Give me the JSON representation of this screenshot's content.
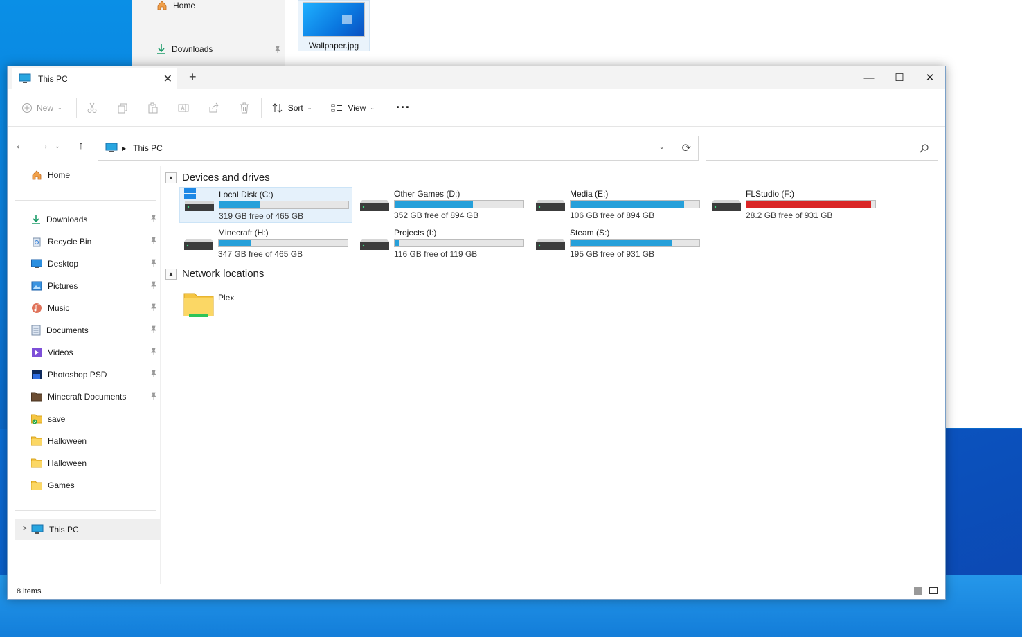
{
  "background_window": {
    "nav_home": "Home",
    "nav_downloads": "Downloads",
    "thumbnail_caption": "Wallpaper.jpg"
  },
  "window": {
    "tab_title": "This PC",
    "new_tab_glyph": "+",
    "close_glyph": "✕",
    "minimize_glyph": "—",
    "maximize_glyph": "☐"
  },
  "toolbar": {
    "new_label": "New",
    "sort_label": "Sort",
    "view_label": "View",
    "more_glyph": "···",
    "icons": [
      "plus-circle-icon",
      "cut-icon",
      "copy-icon",
      "paste-icon",
      "rename-icon",
      "share-icon",
      "delete-icon",
      "sort-icon",
      "view-icon",
      "more-icon"
    ]
  },
  "address": {
    "path": "This PC",
    "search_placeholder": ""
  },
  "sidebar": {
    "home": "Home",
    "items": [
      {
        "label": "Downloads",
        "icon": "download-icon",
        "pinned": true
      },
      {
        "label": "Recycle Bin",
        "icon": "recycle-bin-icon",
        "pinned": true
      },
      {
        "label": "Desktop",
        "icon": "desktop-icon",
        "pinned": true
      },
      {
        "label": "Pictures",
        "icon": "pictures-icon",
        "pinned": true
      },
      {
        "label": "Music",
        "icon": "music-icon",
        "pinned": true
      },
      {
        "label": "Documents",
        "icon": "documents-icon",
        "pinned": true
      },
      {
        "label": "Videos",
        "icon": "videos-icon",
        "pinned": true
      },
      {
        "label": "Photoshop PSD",
        "icon": "photoshop-icon",
        "pinned": true
      },
      {
        "label": "Minecraft Documents",
        "icon": "folder-dark-icon",
        "pinned": true
      },
      {
        "label": "save",
        "icon": "folder-check-icon",
        "pinned": false
      },
      {
        "label": "Halloween",
        "icon": "folder-icon",
        "pinned": false
      },
      {
        "label": "Halloween",
        "icon": "folder-icon",
        "pinned": false
      },
      {
        "label": "Games",
        "icon": "folder-icon",
        "pinned": false
      }
    ],
    "this_pc": "This PC"
  },
  "content": {
    "devices_header": "Devices and drives",
    "network_header": "Network locations",
    "drives": [
      {
        "name": "Local Disk (C:)",
        "free": "319 GB free of 465 GB",
        "used_fraction": 0.31,
        "color": "#26a0da",
        "system": true
      },
      {
        "name": "Other Games (D:)",
        "free": "352 GB free of 894 GB",
        "used_fraction": 0.61,
        "color": "#26a0da"
      },
      {
        "name": "Media (E:)",
        "free": "106 GB free of 894 GB",
        "used_fraction": 0.88,
        "color": "#26a0da"
      },
      {
        "name": "FLStudio (F:)",
        "free": "28.2 GB free of 931 GB",
        "used_fraction": 0.97,
        "color": "#da2626"
      },
      {
        "name": "Minecraft (H:)",
        "free": "347 GB free of 465 GB",
        "used_fraction": 0.25,
        "color": "#26a0da"
      },
      {
        "name": "Projects (I:)",
        "free": "116 GB free of 119 GB",
        "used_fraction": 0.03,
        "color": "#26a0da"
      },
      {
        "name": "Steam (S:)",
        "free": "195 GB free of 931 GB",
        "used_fraction": 0.79,
        "color": "#26a0da"
      }
    ],
    "network": [
      {
        "name": "Plex",
        "icon": "network-folder-icon"
      }
    ]
  },
  "status": {
    "item_count": "8 items"
  }
}
